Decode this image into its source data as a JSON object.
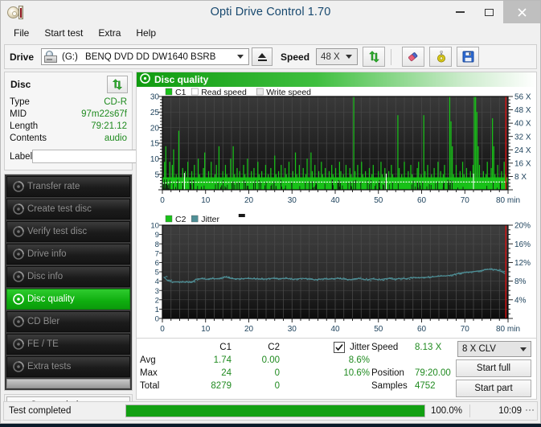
{
  "window": {
    "title": "Opti Drive Control 1.70",
    "app_icon": "cd-case-icon",
    "controls": {
      "minimize": "minimize-icon",
      "maximize": "maximize-icon",
      "close": "close-icon"
    }
  },
  "menubar": {
    "items": [
      {
        "label": "File"
      },
      {
        "label": "Start test"
      },
      {
        "label": "Extra"
      },
      {
        "label": "Help"
      }
    ]
  },
  "toolbar": {
    "drive_label": "Drive",
    "drive_letter": "(G:)",
    "drive_name": "BENQ DVD DD DW1640 BSRB",
    "eject_icon": "eject-icon",
    "speed_label": "Speed",
    "speed_value": "48 X",
    "refresh_icon": "refresh-icon",
    "eraser_icon": "eraser-icon",
    "settings_icon": "gear-icon",
    "save_icon": "save-floppy-icon"
  },
  "disc_panel": {
    "title": "Disc",
    "refresh_icon": "refresh-icon",
    "rows": [
      {
        "key": "Type",
        "value": "CD-R"
      },
      {
        "key": "MID",
        "value": "97m22s67f"
      },
      {
        "key": "Length",
        "value": "79:21.12"
      },
      {
        "key": "Contents",
        "value": "audio"
      }
    ],
    "label_key": "Label",
    "label_value": "",
    "label_placeholder": "",
    "cd_button_icon": "cd-disc-icon"
  },
  "nav": {
    "items": [
      {
        "label": "Transfer rate",
        "icon": "disc-icon",
        "active": false
      },
      {
        "label": "Create test disc",
        "icon": "disc-icon",
        "active": false
      },
      {
        "label": "Verify test disc",
        "icon": "disc-icon",
        "active": false
      },
      {
        "label": "Drive info",
        "icon": "disc-icon",
        "active": false
      },
      {
        "label": "Disc info",
        "icon": "disc-icon",
        "active": false
      },
      {
        "label": "Disc quality",
        "icon": "disc-icon",
        "active": true
      },
      {
        "label": "CD Bler",
        "icon": "disc-icon",
        "active": false
      },
      {
        "label": "FE / TE",
        "icon": "disc-icon",
        "active": false
      },
      {
        "label": "Extra tests",
        "icon": "disc-icon",
        "active": false
      }
    ],
    "status_window_label": "Status window > >"
  },
  "panel": {
    "header_title": "Disc quality",
    "header_icon": "disc-icon"
  },
  "stats": {
    "columns": [
      "C1",
      "C2"
    ],
    "jitter_label": "Jitter",
    "jitter_checked": true,
    "rows": [
      {
        "key": "Avg",
        "c1": "1.74",
        "c2": "0.00",
        "jitter": "8.6%"
      },
      {
        "key": "Max",
        "c1": "24",
        "c2": "0",
        "jitter": "10.6%"
      },
      {
        "key": "Total",
        "c1": "8279",
        "c2": "0",
        "jitter": ""
      }
    ],
    "info": [
      {
        "key": "Speed",
        "value": "8.13 X"
      },
      {
        "key": "Position",
        "value": "79:20.00"
      },
      {
        "key": "Samples",
        "value": "4752"
      }
    ],
    "write_strategy": "8 X CLV",
    "start_full_label": "Start full",
    "start_part_label": "Start part"
  },
  "statusbar": {
    "message": "Test completed",
    "progress_percent": 100.0,
    "progress_text": "100.0%",
    "elapsed": "10:09"
  },
  "colors": {
    "c1_green": "#19c219",
    "jitter_teal": "#4f8f96",
    "accent_green": "#0f9b0f",
    "value_green": "#1f8a1f",
    "axis_text": "#20445e",
    "plot_bg_top": "#3a3a3a",
    "plot_bg_bottom": "#0d0d0d",
    "cursor_red": "#e01010"
  },
  "chart_data": [
    {
      "type": "area",
      "name": "c1-chart",
      "title": "",
      "xlabel": "min",
      "ylabel": "C1",
      "xlim": [
        0,
        80
      ],
      "ylim": [
        0,
        30
      ],
      "xticks": [
        0,
        10,
        20,
        30,
        40,
        50,
        60,
        70,
        80
      ],
      "yticks": [
        5,
        10,
        15,
        20,
        25,
        30
      ],
      "y2label": "X",
      "y2lim": [
        0,
        56
      ],
      "y2ticks": [
        8,
        16,
        24,
        32,
        40,
        48,
        56
      ],
      "grid": true,
      "legend": [
        {
          "label": "C1",
          "color": "#19c219"
        },
        {
          "label": "Read speed",
          "color": "#ffffff"
        },
        {
          "label": "Write speed",
          "color": "#e8e8e8"
        }
      ],
      "cursor_x": 79.5,
      "series": [
        {
          "name": "C1",
          "color": "#19c219",
          "x": [
            0.2,
            0.5,
            0.8,
            1.1,
            1.4,
            1.7,
            2.0,
            2.3,
            2.6,
            2.9,
            3.2,
            3.5,
            3.8,
            4.1,
            4.4,
            4.7,
            5.0,
            5.3,
            5.6,
            5.9,
            6.2,
            6.5,
            6.8,
            7.1,
            7.4,
            7.7,
            8.0,
            8.3,
            8.6,
            8.9,
            9.2,
            9.5,
            9.8,
            10.1,
            10.4,
            10.7,
            11.0,
            11.3,
            11.6,
            11.9,
            12.2,
            12.5,
            12.8,
            13.1,
            13.4,
            13.7,
            14.0,
            14.3,
            14.6,
            14.9,
            15.2,
            15.5,
            15.8,
            16.1,
            16.4,
            16.7,
            17.0,
            17.3,
            17.6,
            17.9,
            18.2,
            18.5,
            18.8,
            19.1,
            19.4,
            19.7,
            20.0,
            20.3,
            20.6,
            20.9,
            21.2,
            21.5,
            21.8,
            22.1,
            22.4,
            22.7,
            23.0,
            23.3,
            23.6,
            23.9,
            24.2,
            24.5,
            24.8,
            25.1,
            25.4,
            25.7,
            26.0,
            26.3,
            26.6,
            26.9,
            27.2,
            27.5,
            27.8,
            28.1,
            28.4,
            28.7,
            29.0,
            29.3,
            29.6,
            29.9,
            30.2,
            30.5,
            30.8,
            31.1,
            31.4,
            31.7,
            32.0,
            32.3,
            32.6,
            32.9,
            33.2,
            33.5,
            33.8,
            34.1,
            34.4,
            34.7,
            35.0,
            35.3,
            35.6,
            35.9,
            36.2,
            36.5,
            36.8,
            37.1,
            37.4,
            37.7,
            38.0,
            38.3,
            38.6,
            38.9,
            39.2,
            39.5,
            39.8,
            40.1,
            40.4,
            40.7,
            41.0,
            41.3,
            41.6,
            41.9,
            42.2,
            42.5,
            42.8,
            43.1,
            43.4,
            43.7,
            44.0,
            44.3,
            44.6,
            44.9,
            45.2,
            45.5,
            45.8,
            46.1,
            46.4,
            46.7,
            47.0,
            47.3,
            47.6,
            47.9,
            48.2,
            48.5,
            48.8,
            49.1,
            49.4,
            49.7,
            50.0,
            50.3,
            50.6,
            50.9,
            51.2,
            51.5,
            51.8,
            52.1,
            52.4,
            52.7,
            53.0,
            53.3,
            53.6,
            53.9,
            54.2,
            54.5,
            54.8,
            55.1,
            55.4,
            55.7,
            56.0,
            56.3,
            56.6,
            56.9,
            57.2,
            57.5,
            57.8,
            58.1,
            58.4,
            58.7,
            59.0,
            59.3,
            59.6,
            59.9,
            60.2,
            60.5,
            60.8,
            61.1,
            61.4,
            61.7,
            62.0,
            62.3,
            62.6,
            62.9,
            63.2,
            63.5,
            63.8,
            64.1,
            64.4,
            64.7,
            65.0,
            65.3,
            65.6,
            65.9,
            66.2,
            66.5,
            66.8,
            67.1,
            67.4,
            67.7,
            68.0,
            68.3,
            68.6,
            68.9,
            69.2,
            69.5,
            69.8,
            70.1,
            70.4,
            70.7,
            71.0,
            71.3,
            71.6,
            71.9,
            72.2,
            72.5,
            72.8,
            73.1,
            73.4,
            73.7,
            74.0,
            74.3,
            74.6,
            74.9,
            75.2,
            75.5,
            75.8,
            76.1,
            76.4,
            76.7,
            77.0,
            77.3,
            77.6,
            77.9,
            78.2,
            78.5,
            78.8,
            79.1,
            79.4
          ],
          "y": [
            2,
            9,
            14,
            3,
            4,
            9,
            2,
            8,
            13,
            3,
            5,
            2,
            19,
            4,
            3,
            7,
            2,
            6,
            4,
            9,
            3,
            2,
            6,
            4,
            8,
            2,
            3,
            10,
            5,
            3,
            2,
            7,
            12,
            4,
            2,
            6,
            3,
            9,
            4,
            2,
            5,
            8,
            3,
            14,
            4,
            2,
            6,
            3,
            8,
            5,
            2,
            4,
            10,
            3,
            14,
            5,
            2,
            7,
            3,
            6,
            4,
            2,
            8,
            5,
            3,
            10,
            4,
            2,
            6,
            3,
            7,
            4,
            2,
            9,
            5,
            3,
            6,
            2,
            4,
            8,
            3,
            5,
            2,
            7,
            4,
            3,
            11,
            5,
            2,
            6,
            3,
            8,
            4,
            2,
            7,
            5,
            3,
            9,
            4,
            2,
            6,
            3,
            12,
            5,
            2,
            8,
            4,
            3,
            7,
            2,
            5,
            10,
            4,
            3,
            12,
            6,
            2,
            8,
            4,
            3,
            6,
            2,
            9,
            5,
            3,
            7,
            4,
            2,
            6,
            3,
            8,
            5,
            2,
            7,
            4,
            3,
            9,
            6,
            2,
            5,
            3,
            8,
            4,
            2,
            7,
            5,
            3,
            33,
            6,
            2,
            8,
            4,
            3,
            9,
            5,
            2,
            6,
            4,
            3,
            7,
            2,
            5,
            8,
            3,
            4,
            2,
            6,
            3,
            9,
            5,
            2,
            7,
            4,
            3,
            6,
            2,
            8,
            5,
            3,
            4,
            2,
            24,
            7,
            3,
            5,
            2,
            9,
            4,
            3,
            6,
            2,
            8,
            5,
            3,
            4,
            2,
            7,
            9,
            3,
            5,
            2,
            24,
            6,
            3,
            8,
            4,
            2,
            5,
            3,
            7,
            2,
            4,
            9,
            3,
            6,
            2,
            5,
            8,
            3,
            4,
            2,
            40,
            22,
            14,
            5,
            3,
            8,
            4,
            2,
            6,
            3,
            9,
            5,
            2,
            7,
            4,
            3,
            6,
            2,
            8,
            30,
            43,
            25,
            14,
            8,
            4,
            2,
            6,
            3,
            5,
            9,
            4,
            2,
            7,
            23,
            14,
            5,
            3,
            8,
            4,
            2,
            6,
            3,
            9,
            5,
            3,
            7,
            4,
            2,
            8
          ]
        },
        {
          "name": "Read speed",
          "color": "#ffffff",
          "x": [
            0,
            2,
            6,
            8,
            79.5
          ],
          "y_speed": [
            3.9,
            4.6,
            4.6,
            4.7,
            4.7
          ],
          "note": "flat white read-speed trace near 8X on right axis"
        }
      ]
    },
    {
      "type": "line",
      "name": "c2-jitter-chart",
      "title": "",
      "xlabel": "min",
      "ylabel": "C2",
      "xlim": [
        0,
        80
      ],
      "ylim": [
        0,
        10
      ],
      "xticks": [
        0,
        10,
        20,
        30,
        40,
        50,
        60,
        70,
        80
      ],
      "yticks": [
        1,
        2,
        3,
        4,
        5,
        6,
        7,
        8,
        9,
        10
      ],
      "y2label": "%",
      "y2lim": [
        0,
        20
      ],
      "y2ticks": [
        4,
        8,
        12,
        16,
        20
      ],
      "grid": true,
      "legend": [
        {
          "label": "C2",
          "color": "#19c219"
        },
        {
          "label": "Jitter",
          "color": "#4f8f96"
        }
      ],
      "cursor_x": 79.5,
      "series": [
        {
          "name": "C2",
          "color": "#19c219",
          "x": [
            0,
            79.5
          ],
          "y": [
            0,
            0
          ]
        },
        {
          "name": "Jitter",
          "color": "#4f8f96",
          "x": [
            0.3,
            1.2,
            2.2,
            3.2,
            4.2,
            5.2,
            6.2,
            7.0,
            7.6,
            8.2,
            9.2,
            10.2,
            11.2,
            12.2,
            13.2,
            14.2,
            15.0,
            15.6,
            16.4,
            17.4,
            18.4,
            19.4,
            20.4,
            21.4,
            22.4,
            23.4,
            24.4,
            25.4,
            26.4,
            27.4,
            28.4,
            29.4,
            30.4,
            31.4,
            32.4,
            33.4,
            34.4,
            35.4,
            36.4,
            37.4,
            38.4,
            39.4,
            40.4,
            41.4,
            42.4,
            43.4,
            44.4,
            45.4,
            46.4,
            47.4,
            48.4,
            49.4,
            50.4,
            51.4,
            52.4,
            53.4,
            54.4,
            55.4,
            56.4,
            57.4,
            58.4,
            59.4,
            60.4,
            61.4,
            62.4,
            63.4,
            64.4,
            65.4,
            66.4,
            67.4,
            68.4,
            69.4,
            70.4,
            71.4,
            72.4,
            73.4,
            74.4,
            75.4,
            76.4,
            77.4,
            78.4,
            79.3
          ],
          "y_percent": [
            8.9,
            8.1,
            7.8,
            7.8,
            7.8,
            7.8,
            7.8,
            7.9,
            8.3,
            8.5,
            8.5,
            8.4,
            8.6,
            8.5,
            8.6,
            8.9,
            8.8,
            8.6,
            8.5,
            8.5,
            8.5,
            8.6,
            8.5,
            8.5,
            8.5,
            8.4,
            8.5,
            8.6,
            8.5,
            8.5,
            8.6,
            8.5,
            8.4,
            8.5,
            8.6,
            8.5,
            8.4,
            8.3,
            8.4,
            8.5,
            8.4,
            8.5,
            8.6,
            8.5,
            8.4,
            8.3,
            8.5,
            8.6,
            8.4,
            8.3,
            8.5,
            8.4,
            8.3,
            8.5,
            8.6,
            8.4,
            8.5,
            8.6,
            8.5,
            8.7,
            8.8,
            8.7,
            8.8,
            8.8,
            8.9,
            9.0,
            9.1,
            9.1,
            9.2,
            9.4,
            9.6,
            9.8,
            9.9,
            10.0,
            10.1,
            10.2,
            10.4,
            10.5,
            10.5,
            10.4,
            10.1,
            9.6
          ]
        }
      ]
    }
  ]
}
